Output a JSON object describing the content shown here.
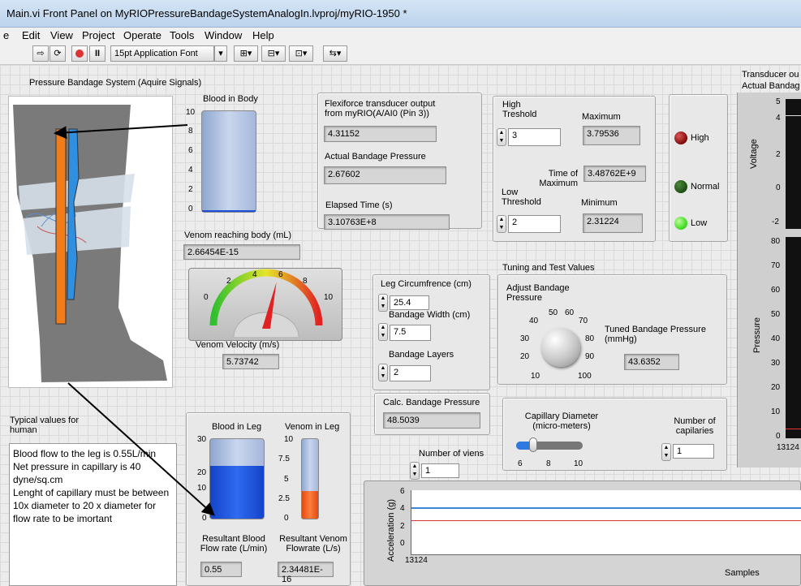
{
  "window": {
    "title": "Main.vi Front Panel on MyRIOPressureBandageSystemAnalogIn.lvproj/myRIO-1950 *"
  },
  "menu": [
    "e",
    "Edit",
    "View",
    "Project",
    "Operate",
    "Tools",
    "Window",
    "Help"
  ],
  "toolbar": {
    "font": "15pt Application Font"
  },
  "panel": {
    "system_title": "Pressure Bandage System (Aquire Signals)",
    "blood_in_body": {
      "label": "Blood in  Body",
      "ticks": [
        "10",
        "8",
        "6",
        "4",
        "2",
        "0"
      ],
      "level": 0.01
    },
    "venom_reaching": {
      "label": "Venom reaching body (mL)",
      "value": "2.66454E-15"
    },
    "gauge": {
      "ticks": [
        "0",
        "2",
        "4",
        "6",
        "8",
        "10"
      ],
      "label": "Venom Velocity (m/s)",
      "value": "5.73742",
      "needle": 5.73742
    },
    "flexiforce": {
      "label": "Flexiforce transducer output from myRIO(A/AI0 (Pin 3))",
      "value": "4.31152",
      "pressure_label": "Actual Bandage Pressure",
      "pressure_value": "2.67602",
      "elapsed_label": "Elapsed Time (s)",
      "elapsed_value": "3.10763E+8"
    },
    "thresholds": {
      "high_label": "High Treshold",
      "high_value": "3",
      "max_label": "Maximum",
      "max_value": "3.79536",
      "tmax_label": "Time of Maximum",
      "tmax_value": "3.48762E+9",
      "low_label": "Low Threshold",
      "low_value": "2",
      "min_label": "Minimum",
      "min_value": "2.31224"
    },
    "leds": [
      {
        "label": "High",
        "color": "#7a0a0a"
      },
      {
        "label": "Normal",
        "color": "#1f4d14"
      },
      {
        "label": "Low",
        "color": "#39d61c"
      }
    ],
    "transducer": {
      "title": "Transducer ou",
      "subtitle": "Actual Bandag",
      "voltage_label": "Voltage",
      "voltage_ticks": [
        "5",
        "4",
        "2",
        "0",
        "-2"
      ],
      "pressure_label": "Pressure",
      "pressure_ticks": [
        "80",
        "70",
        "60",
        "50",
        "40",
        "30",
        "20",
        "10",
        "0"
      ],
      "x_start": "13124"
    },
    "tuning": {
      "title": "Tuning and Test Values",
      "leg_label": "Leg Circumfrence (cm)",
      "leg_value": "25.4",
      "width_label": "Bandage Width (cm)",
      "width_value": "7.5",
      "layers_label": "Bandage Layers",
      "layers_value": "2",
      "adjust_label": "Adjust Bandage Pressure",
      "knob_ticks": [
        "10",
        "20",
        "30",
        "40",
        "50",
        "60",
        "70",
        "80",
        "90",
        "100"
      ],
      "tuned_label": "Tuned Bandage Pressure  (mmHg)",
      "tuned_value": "43.6352",
      "calc_label": "Calc. Bandage Pressure",
      "calc_value": "48.5039"
    },
    "capillary": {
      "diam_label": "Capillary Diameter (micro-meters)",
      "slider_ticks": [
        "6",
        "8",
        "10"
      ],
      "slider_value": 7,
      "num_cap_label": "Number of capilaries",
      "num_cap_value": "1",
      "num_veins_label": "Number of viens",
      "num_veins_value": "1"
    },
    "typical": {
      "title": "Typical values for human",
      "text": "Blood flow to the leg is 0.55L/min\nNet pressure in capillary is 40 dyne/sq.cm\nLenght of capillary must be between 10x diameter to 20 x diameter for flow rate to be imortant"
    },
    "leg_tanks": {
      "blood_label": "Blood in Leg",
      "blood_ticks": [
        "30",
        "20",
        "10",
        "0"
      ],
      "blood_level": 20,
      "venom_label": "Venom in Leg",
      "venom_ticks": [
        "10",
        "7.5",
        "5",
        "2.5",
        "0"
      ],
      "venom_level": 3.5,
      "blood_flow_label": "Resultant Blood Flow rate (L/min)",
      "blood_flow_value": "0.55",
      "venom_flow_label": "Resultant Venom Flowrate (L/s)",
      "venom_flow_value": "2.34481E-16"
    },
    "accel": {
      "ylabel": "Acceleration (g)",
      "yticks": [
        "6",
        "4",
        "2",
        "0"
      ],
      "x_start": "13124",
      "xlabel": "Samples"
    }
  }
}
